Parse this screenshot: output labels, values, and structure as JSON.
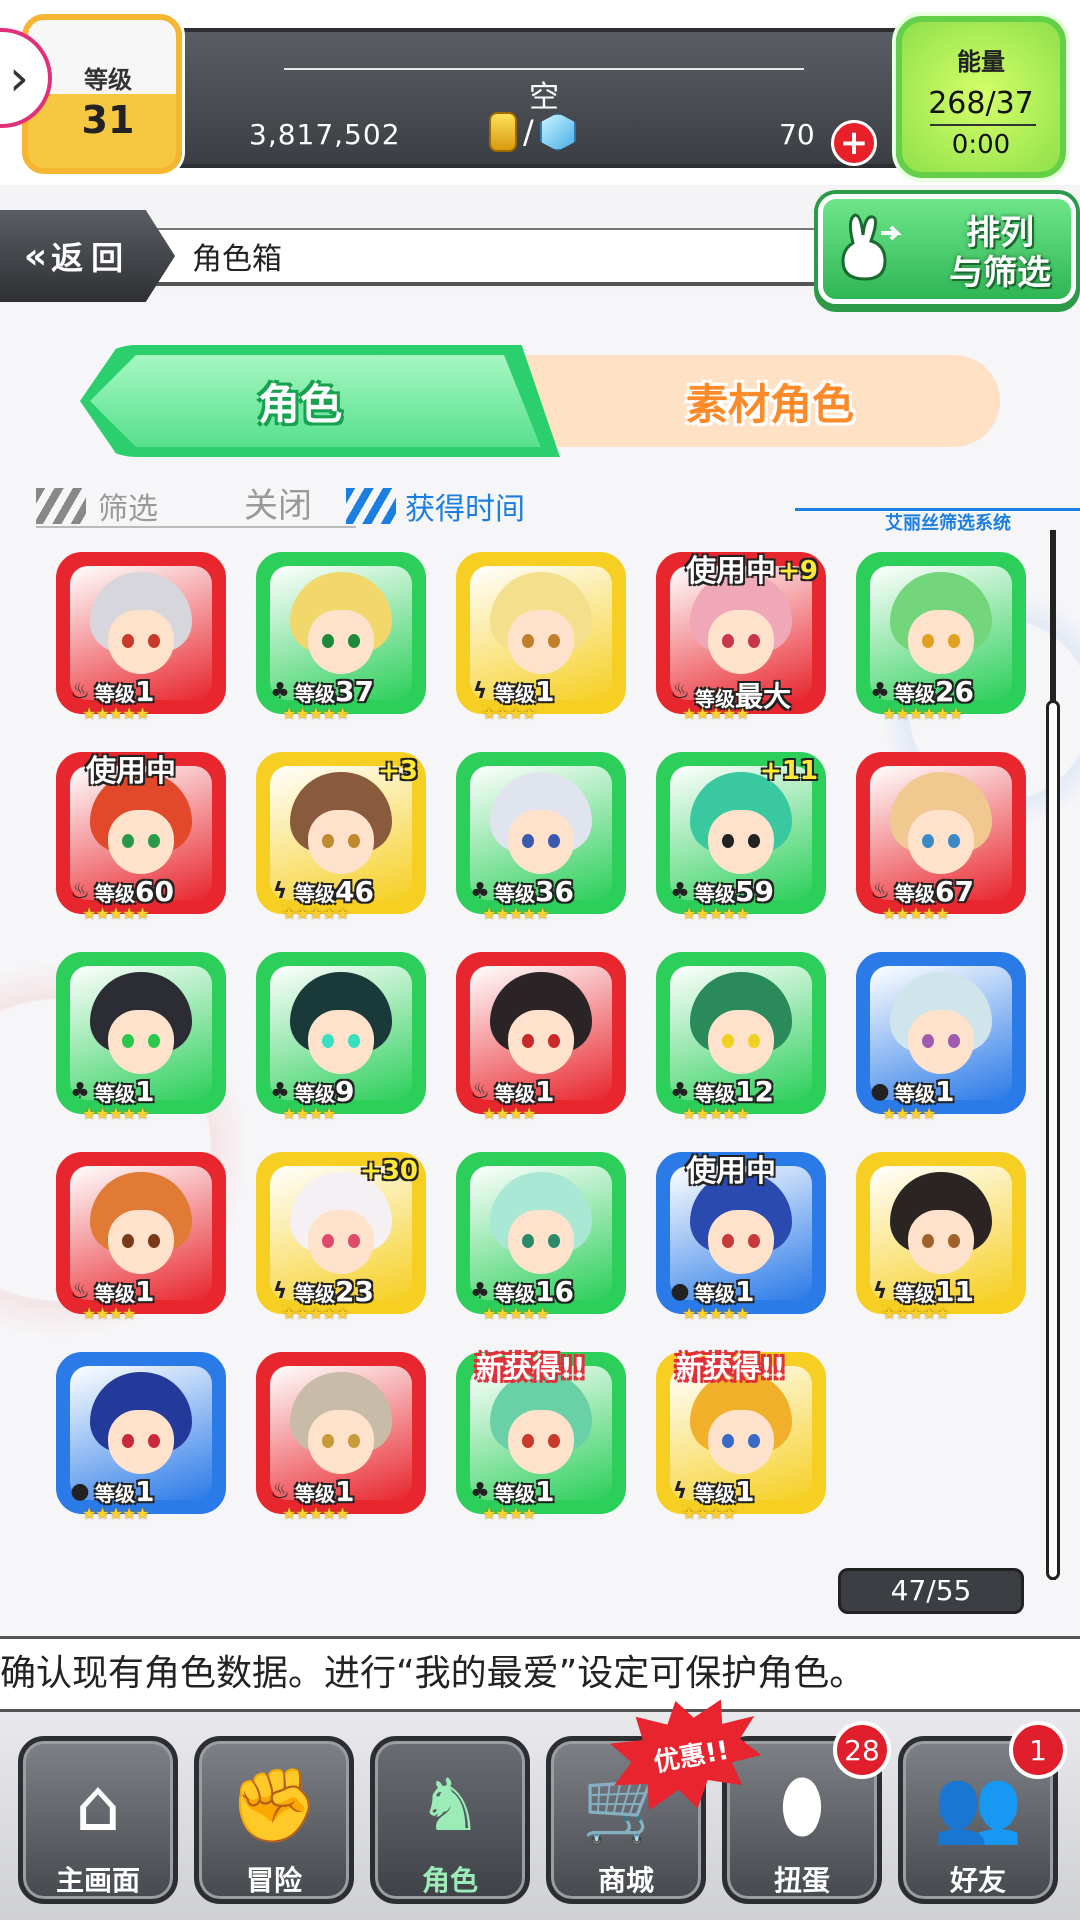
{
  "topbar": {
    "level_label": "等级",
    "level": "31",
    "player_name": "空",
    "gold": "3,817,502",
    "currency_sep": "/",
    "gems": "70",
    "plus": "+",
    "energy_label": "能量",
    "energy": "268/37",
    "energy_timer": "0:00"
  },
  "header": {
    "back_label": "返回",
    "back_chevron": "«",
    "title": "角色箱",
    "sort_label_line1": "排列",
    "sort_label_line2": "与筛选"
  },
  "tabs": {
    "characters": "角色",
    "materials": "素材角色"
  },
  "filter": {
    "filter_label": "筛选",
    "filter_value": "关闭",
    "sort_value": "获得时间",
    "system_label": "艾丽丝筛选系统"
  },
  "level_prefix": "等级",
  "cards": [
    {
      "level": "1",
      "frame": "red",
      "attr": "fire",
      "stars": "★★★★★",
      "tag": "",
      "plus": "",
      "hair": "#d6d6dc",
      "eye": "#c83a2a"
    },
    {
      "level": "37",
      "frame": "green",
      "attr": "wood",
      "stars": "★★★★★",
      "tag": "",
      "plus": "",
      "hair": "#f2d76a",
      "eye": "#1e8a3a"
    },
    {
      "level": "1",
      "frame": "yellow",
      "attr": "thunder",
      "stars": "★★★★",
      "tag": "",
      "plus": "",
      "hair": "#f4e08c",
      "eye": "#c0802a"
    },
    {
      "level": "最大",
      "frame": "red",
      "attr": "fire",
      "stars": "★★★★★",
      "tag": "使用中",
      "plus": "+9",
      "hair": "#f0a8b8",
      "eye": "#c8384a"
    },
    {
      "level": "26",
      "frame": "green",
      "attr": "wood",
      "stars": "★★★★★★",
      "tag": "",
      "plus": "",
      "hair": "#74d67a",
      "eye": "#e0a020"
    },
    {
      "level": "60",
      "frame": "red",
      "attr": "fire",
      "stars": "★★★★★",
      "tag": "使用中",
      "plus": "",
      "hair": "#e2482a",
      "eye": "#2a9a4a"
    },
    {
      "level": "46",
      "frame": "yellow",
      "attr": "thunder",
      "stars": "★★★★★",
      "tag": "",
      "plus": "+3",
      "hair": "#8a5a3c",
      "eye": "#c08a30"
    },
    {
      "level": "36",
      "frame": "green",
      "attr": "wood",
      "stars": "★★★★★",
      "tag": "",
      "plus": "",
      "hair": "#e0e4ee",
      "eye": "#3a5ab0"
    },
    {
      "level": "59",
      "frame": "green",
      "attr": "wood",
      "stars": "★★★★★",
      "tag": "",
      "plus": "+11",
      "hair": "#3ac8a0",
      "eye": "#222222"
    },
    {
      "level": "67",
      "frame": "red",
      "attr": "fire",
      "stars": "★★★★★",
      "tag": "",
      "plus": "",
      "hair": "#f0c890",
      "eye": "#3a8ac8"
    },
    {
      "level": "1",
      "frame": "green",
      "attr": "wood",
      "stars": "★★★★★",
      "tag": "",
      "plus": "",
      "hair": "#2c2c34",
      "eye": "#2ac84a"
    },
    {
      "level": "9",
      "frame": "green",
      "attr": "wood",
      "stars": "★★★★",
      "tag": "",
      "plus": "",
      "hair": "#1a3a3a",
      "eye": "#38e0c0"
    },
    {
      "level": "1",
      "frame": "red",
      "attr": "fire",
      "stars": "★★★★",
      "tag": "",
      "plus": "",
      "hair": "#2a2426",
      "eye": "#c82a2a"
    },
    {
      "level": "12",
      "frame": "green",
      "attr": "wood",
      "stars": "★★★★★",
      "tag": "",
      "plus": "",
      "hair": "#2a8a5a",
      "eye": "#f0d020"
    },
    {
      "level": "1",
      "frame": "blue",
      "attr": "water",
      "stars": "★★★★",
      "tag": "",
      "plus": "",
      "hair": "#d0e4ec",
      "eye": "#a05ab0"
    },
    {
      "level": "1",
      "frame": "red",
      "attr": "fire",
      "stars": "★★★★",
      "tag": "",
      "plus": "",
      "hair": "#e07a34",
      "eye": "#7a3a1a"
    },
    {
      "level": "23",
      "frame": "yellow",
      "attr": "thunder",
      "stars": "★★★★★",
      "tag": "",
      "plus": "+30",
      "hair": "#f4f0f4",
      "eye": "#e04a6a"
    },
    {
      "level": "16",
      "frame": "green",
      "attr": "wood",
      "stars": "★★★★★",
      "tag": "",
      "plus": "",
      "hair": "#a8e8d4",
      "eye": "#2a8a6a"
    },
    {
      "level": "1",
      "frame": "blue",
      "attr": "water",
      "stars": "★★★★★",
      "tag": "使用中",
      "plus": "",
      "hair": "#2a4ab0",
      "eye": "#c83a3a"
    },
    {
      "level": "11",
      "frame": "yellow",
      "attr": "thunder",
      "stars": "★★★★★",
      "tag": "",
      "plus": "",
      "hair": "#2a2422",
      "eye": "#a0602a"
    },
    {
      "level": "1",
      "frame": "blue",
      "attr": "water",
      "stars": "★★★★★",
      "tag": "",
      "plus": "",
      "hair": "#243a9a",
      "eye": "#c82a3a"
    },
    {
      "level": "1",
      "frame": "red",
      "attr": "fire",
      "stars": "★★★★★",
      "tag": "",
      "plus": "",
      "hair": "#c8bca8",
      "eye": "#c89a3a"
    },
    {
      "level": "1",
      "frame": "green",
      "attr": "wood",
      "stars": "★★★★",
      "tag": "新获得!!",
      "plus": "",
      "hair": "#6ad0a8",
      "eye": "#c83a2a"
    },
    {
      "level": "1",
      "frame": "yellow",
      "attr": "thunder",
      "stars": "★★★★",
      "tag": "新获得!!",
      "plus": "",
      "hair": "#f0b02a",
      "eye": "#3a6ac8"
    }
  ],
  "count": "47/55",
  "message": "确认现有角色数据。进行“我的最爱”设定可保护角色。",
  "nav": {
    "home": "主画面",
    "adventure": "冒险",
    "characters": "角色",
    "shop": "商城",
    "gacha": "扭蛋",
    "friends": "好友",
    "gacha_badge": "28",
    "friends_badge": "1",
    "promo": "优惠!!"
  },
  "colors": {
    "red": "#e8262e",
    "green": "#2ccf5a",
    "yellow": "#f6cf22",
    "blue": "#2a7ae8",
    "accent_blue": "#1a7fe0",
    "energy_green": "#8ee04a"
  }
}
